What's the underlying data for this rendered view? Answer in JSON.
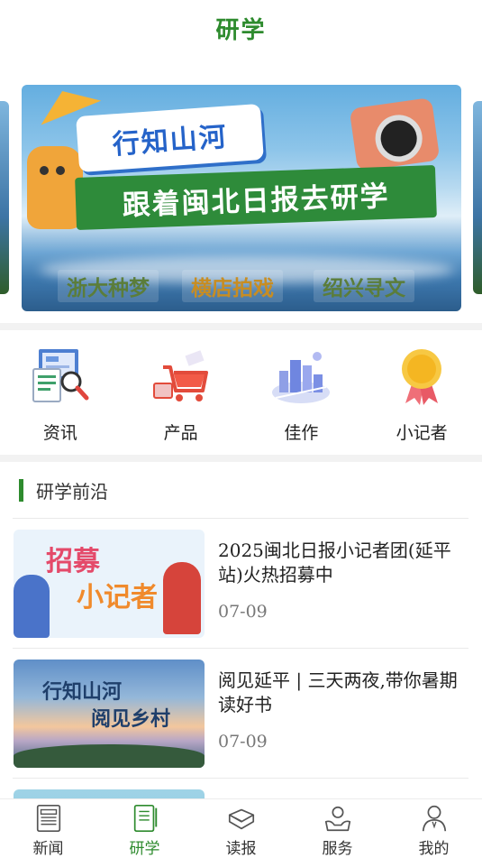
{
  "header": {
    "title": "研学"
  },
  "banner": {
    "tag": "行知山河",
    "headline": "跟着闽北日报去研学",
    "subtitles": [
      "浙大种梦",
      "横店拍戏",
      "绍兴寻文"
    ]
  },
  "quicknav": {
    "items": [
      {
        "label": "资讯",
        "icon": "news-report-icon"
      },
      {
        "label": "产品",
        "icon": "shopping-cart-icon"
      },
      {
        "label": "佳作",
        "icon": "city-buildings-icon"
      },
      {
        "label": "小记者",
        "icon": "medal-icon"
      }
    ]
  },
  "section": {
    "title": "研学前沿"
  },
  "articles": [
    {
      "title": "2025闽北日报小记者团(延平站)火热招募中",
      "date": "07-09",
      "thumb_text_a": "招募",
      "thumb_text_b": "小记者"
    },
    {
      "title": "阅见延平 | 三天两夜,带你暑期读好书",
      "date": "07-09",
      "thumb_text_a": "行知山河",
      "thumb_text_b": "阅见乡村"
    }
  ],
  "tabbar": {
    "tabs": [
      {
        "label": "新闻",
        "icon": "newspaper-icon",
        "active": false
      },
      {
        "label": "研学",
        "icon": "notebook-icon",
        "active": true
      },
      {
        "label": "读报",
        "icon": "reading-icon",
        "active": false
      },
      {
        "label": "服务",
        "icon": "service-hands-icon",
        "active": false
      },
      {
        "label": "我的",
        "icon": "user-icon",
        "active": false
      }
    ]
  },
  "colors": {
    "accent": "#2e8b2e",
    "divider": "#f2f2f2"
  }
}
